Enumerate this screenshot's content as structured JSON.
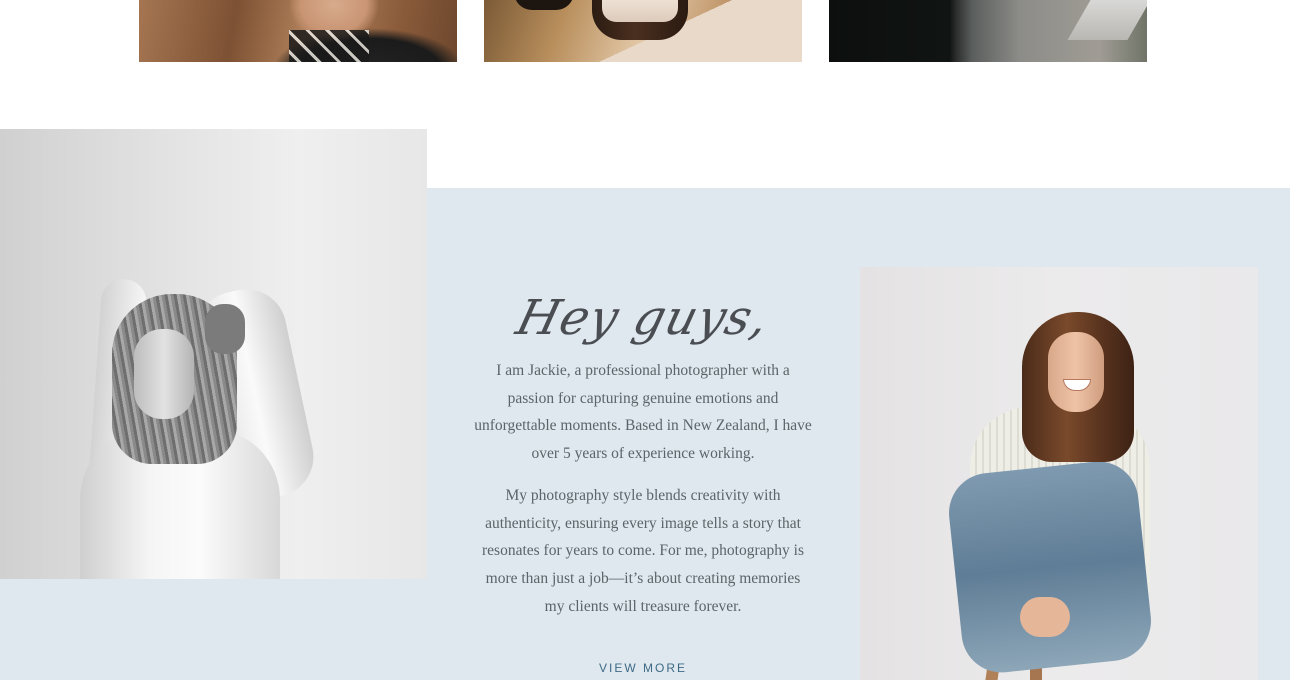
{
  "gallery": {
    "images": [
      {
        "name": "portrait-curly-hair-photo"
      },
      {
        "name": "candle-jar-photo"
      },
      {
        "name": "dark-interior-photo"
      }
    ]
  },
  "about": {
    "greeting": "Hey guys,",
    "paragraphs": [
      "I am Jackie, a professional photographer with a passion for capturing genuine emotions and unforgettable moments. Based in New Zealand, I have over 5 years of experience working.",
      "My photography style blends creativity with authenticity, ensuring every image tells a story that resonates for years to come. For me, photography is more than just a job—it’s about creating memories my clients will treasure forever."
    ],
    "cta_label": "VIEW MORE"
  },
  "colors": {
    "band_background": "#dee8ee",
    "heading": "#4a4d52",
    "body_text": "#5b6469",
    "link": "#3f6a86"
  }
}
